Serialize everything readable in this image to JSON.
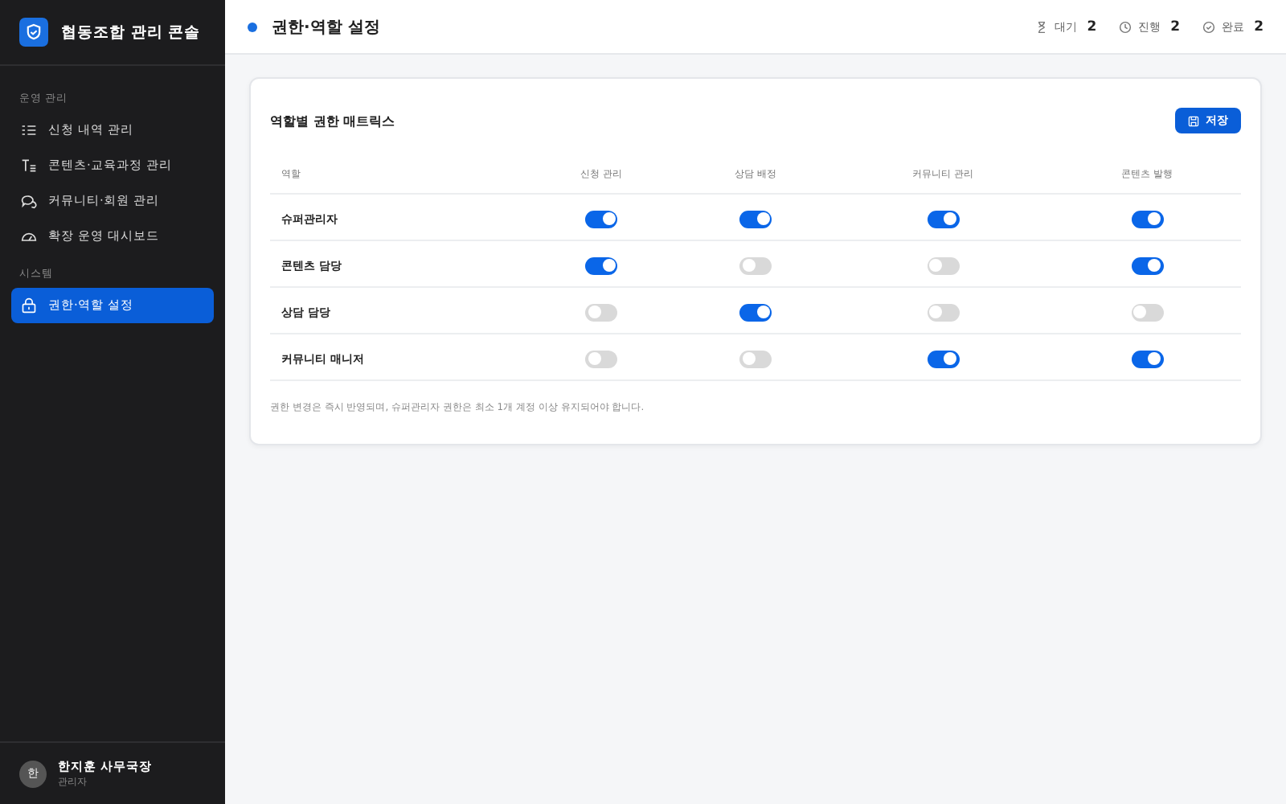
{
  "sidebar": {
    "brand": "협동조합 관리 콘솔",
    "sections": [
      {
        "title": "운영 관리",
        "items": [
          {
            "label": "신청 내역 관리",
            "kind": "list",
            "selected": false
          },
          {
            "label": "콘텐츠·교육과정 관리",
            "kind": "text",
            "selected": false
          },
          {
            "label": "커뮤니티·회원 관리",
            "kind": "chat",
            "selected": false
          },
          {
            "label": "확장 운영 대시보드",
            "kind": "gauge",
            "selected": false
          }
        ]
      },
      {
        "title": "시스템",
        "items": [
          {
            "label": "권한·역할 설정",
            "kind": "lock",
            "selected": true
          }
        ]
      }
    ],
    "user": {
      "avatar": "한",
      "name": "한지훈 사무국장",
      "role": "관리자"
    }
  },
  "header": {
    "title": "권한·역할 설정",
    "stats": [
      {
        "kind": "hourglass",
        "label": "대기",
        "value": "2"
      },
      {
        "kind": "clock",
        "label": "진행",
        "value": "2"
      },
      {
        "kind": "check",
        "label": "완료",
        "value": "2"
      }
    ]
  },
  "card": {
    "title": "역할별 권한 매트릭스",
    "save_button": "저장",
    "columns": [
      "역할",
      "신청 관리",
      "상담 배정",
      "커뮤니티 관리",
      "콘텐츠 발행"
    ],
    "rows": [
      {
        "role": "슈퍼관리자",
        "permissions": [
          {
            "on": true
          },
          {
            "on": true
          },
          {
            "on": true
          },
          {
            "on": true
          }
        ]
      },
      {
        "role": "콘텐츠 담당",
        "permissions": [
          {
            "on": true
          },
          {
            "on": false
          },
          {
            "on": false
          },
          {
            "on": true
          }
        ]
      },
      {
        "role": "상담 담당",
        "permissions": [
          {
            "on": false
          },
          {
            "on": true
          },
          {
            "on": false
          },
          {
            "on": false
          }
        ]
      },
      {
        "role": "커뮤니티 매니저",
        "permissions": [
          {
            "on": false
          },
          {
            "on": false
          },
          {
            "on": true
          },
          {
            "on": true
          }
        ]
      }
    ],
    "note": "권한 변경은 즉시 반영되며, 슈퍼관리자 권한은 최소 1개 계정 이상 유지되어야 합니다."
  }
}
